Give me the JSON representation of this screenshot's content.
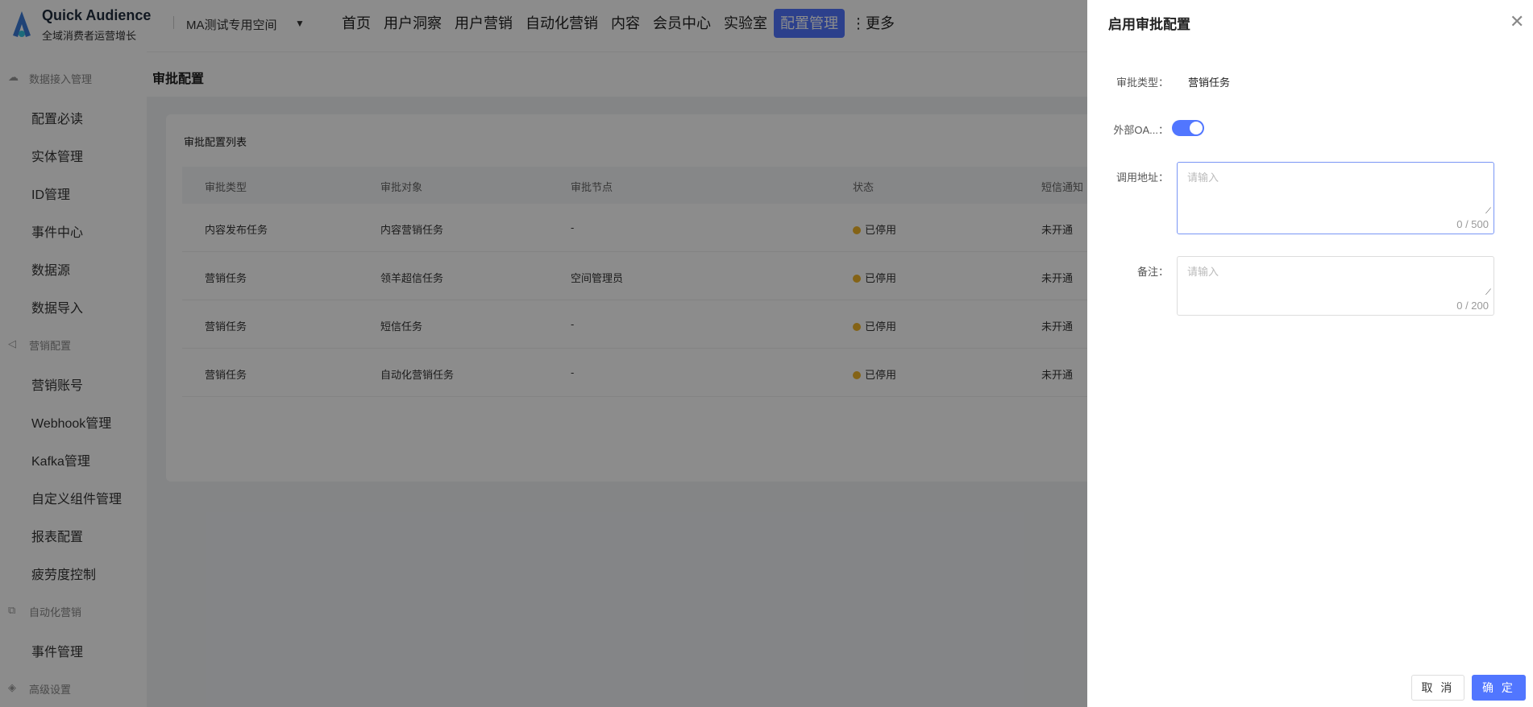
{
  "header": {
    "brand": "Quick Audience",
    "brand_sub": "全域消费者运营增长",
    "space": "MA测试专用空间",
    "nav": [
      "首页",
      "用户洞察",
      "用户营销",
      "自动化营销",
      "内容",
      "会员中心",
      "实验室",
      "配置管理",
      "⋮更多"
    ],
    "active_nav": "配置管理"
  },
  "sidebar": [
    {
      "type": "group",
      "label": "数据接入管理",
      "icon": "cloud-icon"
    },
    {
      "label": "配置必读"
    },
    {
      "label": "实体管理"
    },
    {
      "label": "ID管理"
    },
    {
      "label": "事件中心"
    },
    {
      "label": "数据源"
    },
    {
      "label": "数据导入"
    },
    {
      "type": "group",
      "label": "营销配置",
      "icon": "send-icon"
    },
    {
      "label": "营销账号"
    },
    {
      "label": "Webhook管理"
    },
    {
      "label": "Kafka管理"
    },
    {
      "label": "自定义组件管理"
    },
    {
      "label": "报表配置"
    },
    {
      "label": "疲劳度控制"
    },
    {
      "type": "group",
      "label": "自动化营销",
      "icon": "flow-icon"
    },
    {
      "label": "事件管理"
    },
    {
      "type": "group",
      "label": "高级设置",
      "icon": "settings-icon"
    }
  ],
  "page": {
    "title": "审批配置",
    "card_title": "审批配置列表",
    "columns": [
      "审批类型",
      "审批对象",
      "审批节点",
      "状态",
      "短信通知"
    ],
    "rows": [
      [
        "内容发布任务",
        "内容营销任务",
        "-",
        "已停用",
        "未开通"
      ],
      [
        "营销任务",
        "领羊超信任务",
        "空间管理员",
        "已停用",
        "未开通"
      ],
      [
        "营销任务",
        "短信任务",
        "-",
        "已停用",
        "未开通"
      ],
      [
        "营销任务",
        "自动化营销任务",
        "-",
        "已停用",
        "未开通"
      ]
    ]
  },
  "drawer": {
    "title": "启用审批配置",
    "type_label": "审批类型：",
    "type_value": "营销任务",
    "oa_label": "外部OA...：",
    "oa_enabled": true,
    "url_label": "调用地址：",
    "url_placeholder": "请输入",
    "url_count": "0 / 500",
    "note_label": "备注：",
    "note_placeholder": "请输入",
    "note_count": "0 / 200",
    "cancel": "取 消",
    "ok": "确 定"
  },
  "colors": {
    "accent": "#5176ff",
    "status_stopped": "#f0b429"
  }
}
